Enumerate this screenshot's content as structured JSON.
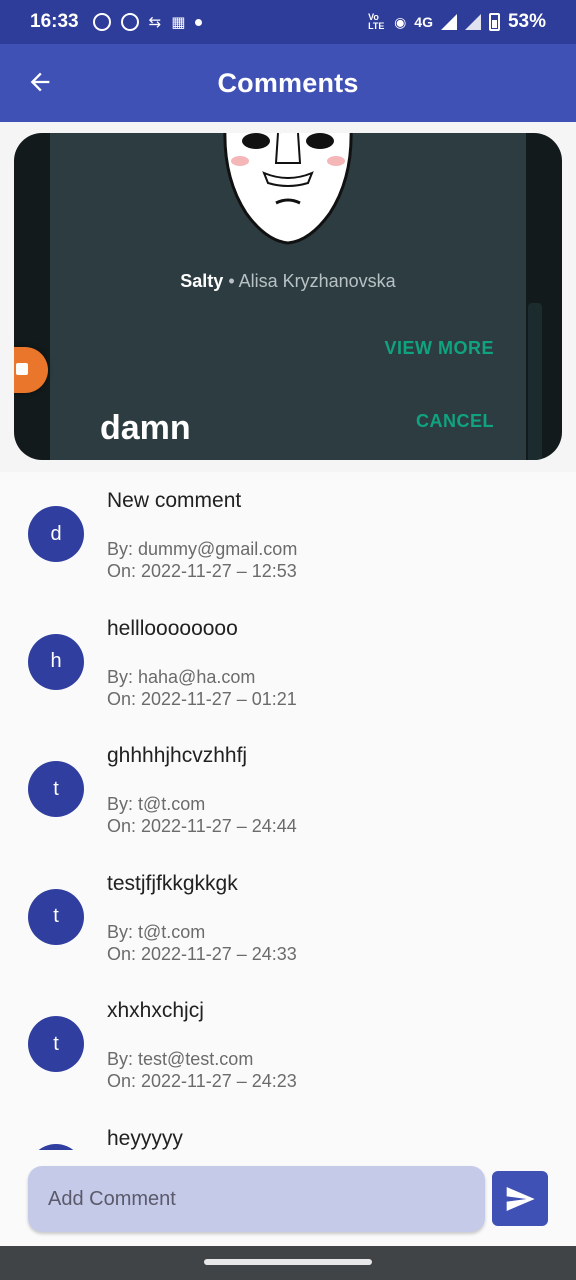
{
  "status_bar": {
    "time": "16:33",
    "network": "4G",
    "volte": "Vo LTE",
    "battery": "53%"
  },
  "app_bar": {
    "title": "Comments"
  },
  "media": {
    "sticker_name": "Salty",
    "separator": " • ",
    "sticker_author": "Alisa Kryzhanovska",
    "view_more": "VIEW MORE",
    "cancel": "CANCEL",
    "caption": "damn",
    "accent_color": "#10a37f"
  },
  "comments": [
    {
      "initial": "d",
      "text": "New comment",
      "by": "By: dummy@gmail.com",
      "on": "On: 2022-11-27 – 12:53"
    },
    {
      "initial": "h",
      "text": "hellloooooooo",
      "by": "By: haha@ha.com",
      "on": "On: 2022-11-27 – 01:21"
    },
    {
      "initial": "t",
      "text": "ghhhhjhcvzhhfj",
      "by": "By: t@t.com",
      "on": "On: 2022-11-27 – 24:44"
    },
    {
      "initial": "t",
      "text": "testjfjfkkgkkgk",
      "by": "By: t@t.com",
      "on": "On: 2022-11-27 – 24:33"
    },
    {
      "initial": "t",
      "text": "xhxhxchjcj",
      "by": "By: test@test.com",
      "on": "On: 2022-11-27 – 24:23"
    },
    {
      "initial": "",
      "text": "heyyyyy",
      "by": "",
      "on": ""
    }
  ],
  "input": {
    "placeholder": "Add Comment",
    "value": ""
  },
  "colors": {
    "primary": "#3f51b5",
    "primary_dark": "#2f3d9a",
    "avatar": "#303f9f",
    "input_bg": "#c5cae9"
  }
}
